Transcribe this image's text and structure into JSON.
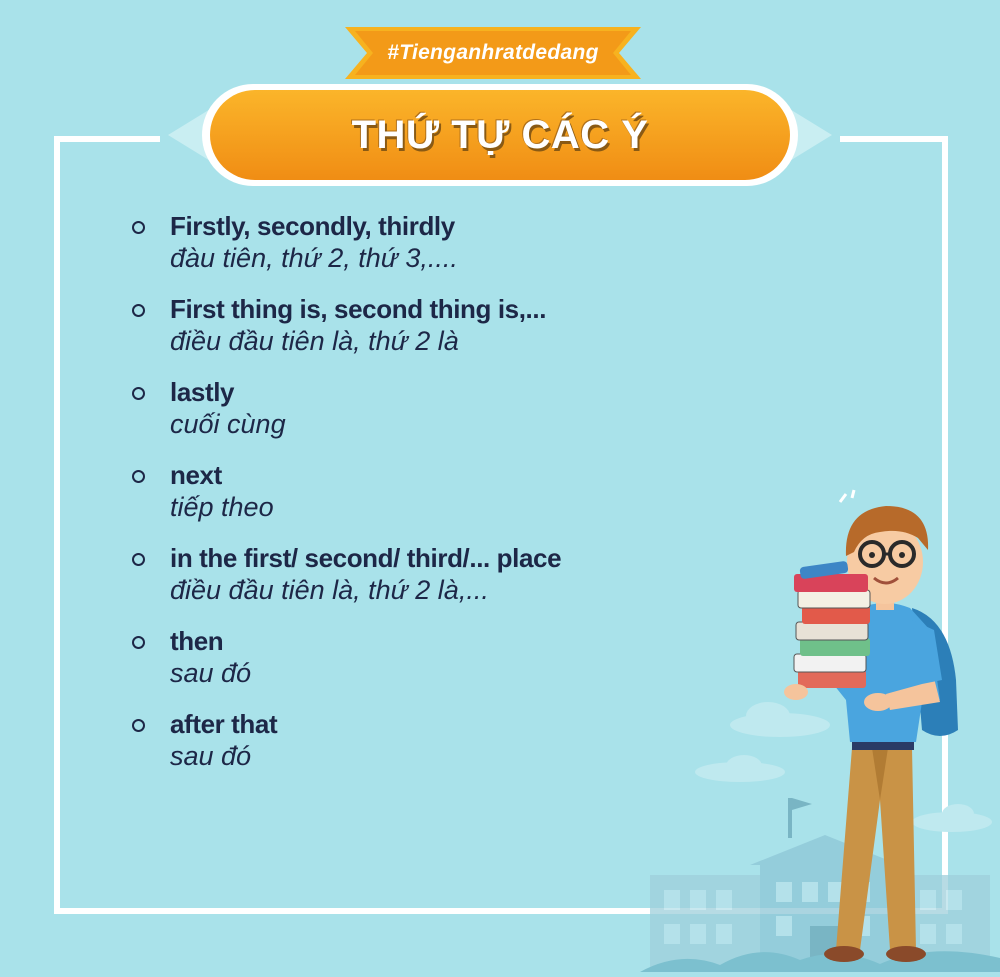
{
  "hashtag": "#Tienganhratdedang",
  "title": "THỨ TỰ CÁC Ý",
  "items": [
    {
      "en": "Firstly, secondly, thirdly",
      "vi": "đàu tiên, thứ 2, thứ 3,...."
    },
    {
      "en": "First thing is, second thing is,...",
      "vi": "điều đầu tiên là, thứ 2 là"
    },
    {
      "en": "lastly",
      "vi": "cuối cùng"
    },
    {
      "en": "next",
      "vi": "tiếp theo"
    },
    {
      "en": "in the first/ second/ third/... place",
      "vi": "điều đầu tiên là, thứ 2 là,..."
    },
    {
      "en": "then",
      "vi": "sau đó"
    },
    {
      "en": "after that",
      "vi": "sau đó"
    }
  ],
  "colors": {
    "background": "#a9e2ea",
    "banner_orange": "#f5a21f",
    "text_navy": "#1d2747",
    "frame": "#ffffff"
  },
  "illustration": {
    "icons": [
      "student-with-books",
      "school-building",
      "cloud"
    ]
  }
}
